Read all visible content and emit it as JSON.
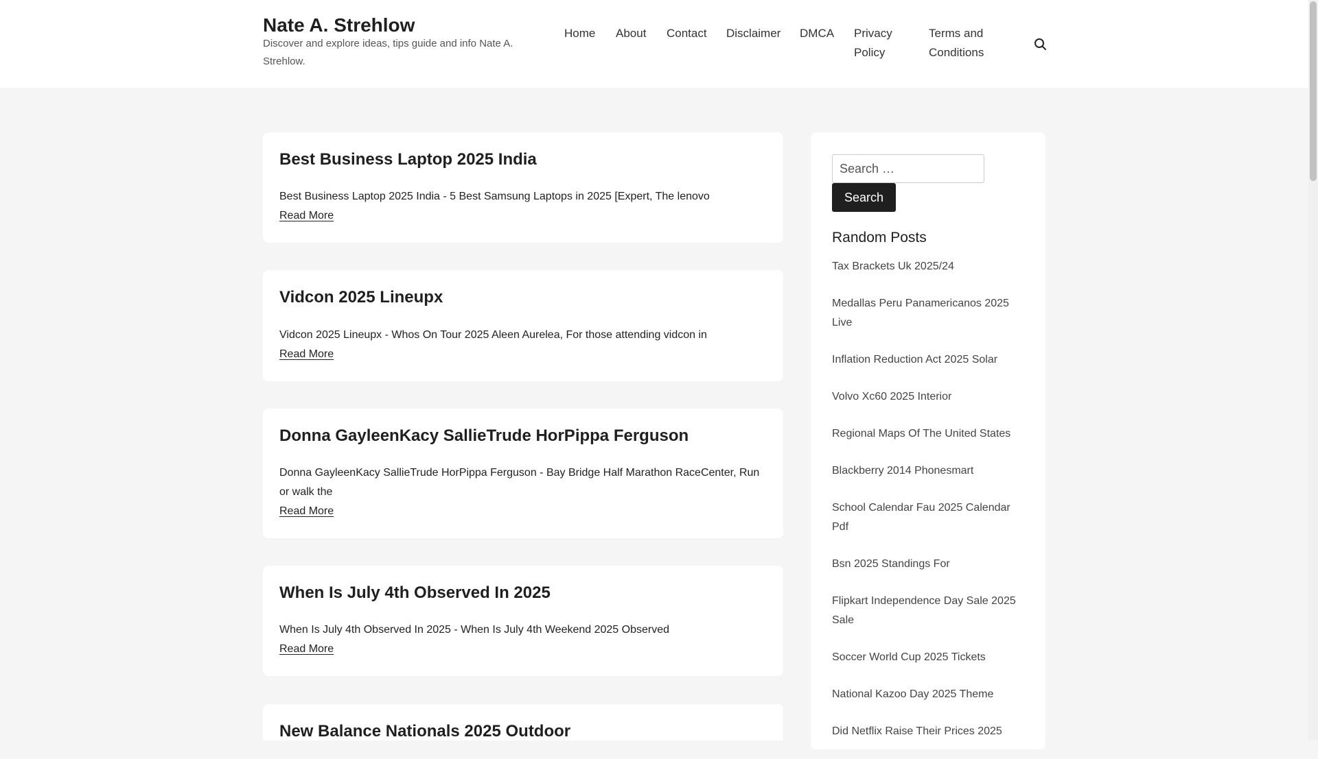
{
  "site": {
    "title": "Nate A. Strehlow",
    "description": "Discover and explore ideas, tips guide and info Nate A. Strehlow."
  },
  "nav": {
    "home": "Home",
    "about": "About",
    "contact": "Contact",
    "disclaimer": "Disclaimer",
    "dmca": "DMCA",
    "privacy": "Privacy Policy",
    "terms": "Terms and Conditions",
    "search_icon": "search-icon"
  },
  "posts": [
    {
      "title": "Best Business Laptop 2025 India",
      "excerpt": "Best Business Laptop 2025 India - 5 Best Samsung Laptops in 2025 [Expert, The lenovo",
      "more": "Read More"
    },
    {
      "title": "Vidcon 2025 Lineupx",
      "excerpt": "Vidcon 2025 Lineupx - Whos On Tour 2025 Aleen Aurelea, For those attending vidcon in",
      "more": "Read More"
    },
    {
      "title": "Donna GayleenKacy SallieTrude HorPippa Ferguson",
      "excerpt": "Donna GayleenKacy SallieTrude HorPippa Ferguson - Bay Bridge Half Marathon RaceCenter, Run or walk the",
      "more": "Read More"
    },
    {
      "title": "When Is July 4th Observed In 2025",
      "excerpt": "When Is July 4th Observed In 2025 - When Is July 4th Weekend 2025 Observed",
      "more": "Read More"
    },
    {
      "title": "New Balance Nationals 2025 Outdoor"
    }
  ],
  "sidebar": {
    "search_placeholder": "Search …",
    "search_button": "Search",
    "random_title": "Random Posts",
    "random_posts": [
      "Tax Brackets Uk 2025/24",
      "Medallas Peru Panamericanos 2025 Live",
      "Inflation Reduction Act 2025 Solar",
      "Volvo Xc60 2025 Interior",
      "Regional Maps Of The United States",
      "Blackberry 2014 Phonesmart",
      "School Calendar Fau 2025 Calendar Pdf",
      "Bsn 2025 Standings For",
      "Flipkart Independence Day Sale 2025 Sale",
      "Soccer World Cup 2025 Tickets",
      "National Kazoo Day 2025 Theme",
      "Did Netflix Raise Their Prices 2025"
    ]
  }
}
